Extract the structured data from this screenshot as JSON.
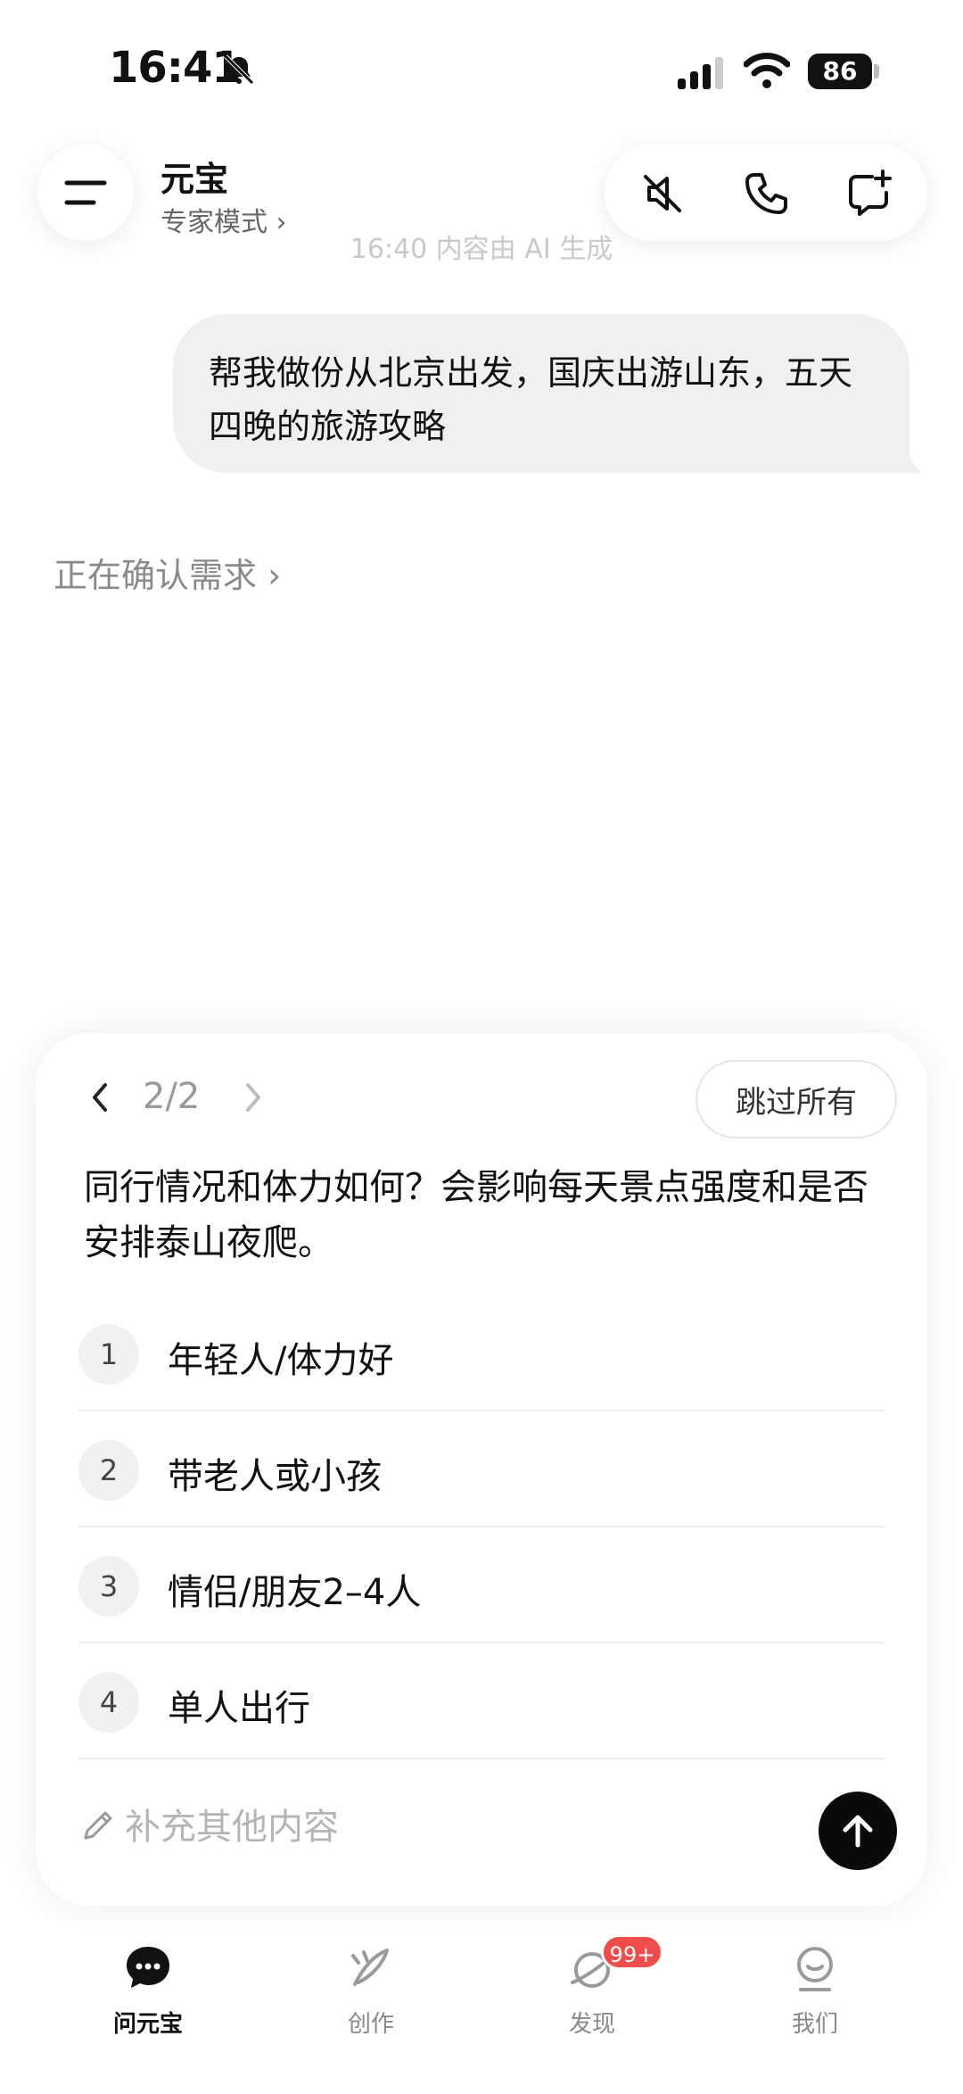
{
  "status_bar": {
    "time": "16:41",
    "battery": "86"
  },
  "header": {
    "title": "元宝",
    "subtitle": "专家模式 ›"
  },
  "timestamp": "16:40 内容由 AI 生成",
  "user_message": "帮我做份从北京出发，国庆出游山东，五天四晚的旅游攻略",
  "status_line": "正在确认需求 ›",
  "card": {
    "pager": "2/2",
    "skip_label": "跳过所有",
    "question": "同行情况和体力如何？会影响每天景点强度和是否安排泰山夜爬。",
    "options": [
      {
        "num": "1",
        "label": "年轻人/体力好"
      },
      {
        "num": "2",
        "label": "带老人或小孩"
      },
      {
        "num": "3",
        "label": "情侣/朋友2–4人"
      },
      {
        "num": "4",
        "label": "单人出行"
      }
    ],
    "input_placeholder": "补充其他内容"
  },
  "tabs": [
    {
      "label": "问元宝",
      "active": true
    },
    {
      "label": "创作"
    },
    {
      "label": "发现"
    },
    {
      "label": "我们"
    }
  ],
  "badge": "99+"
}
